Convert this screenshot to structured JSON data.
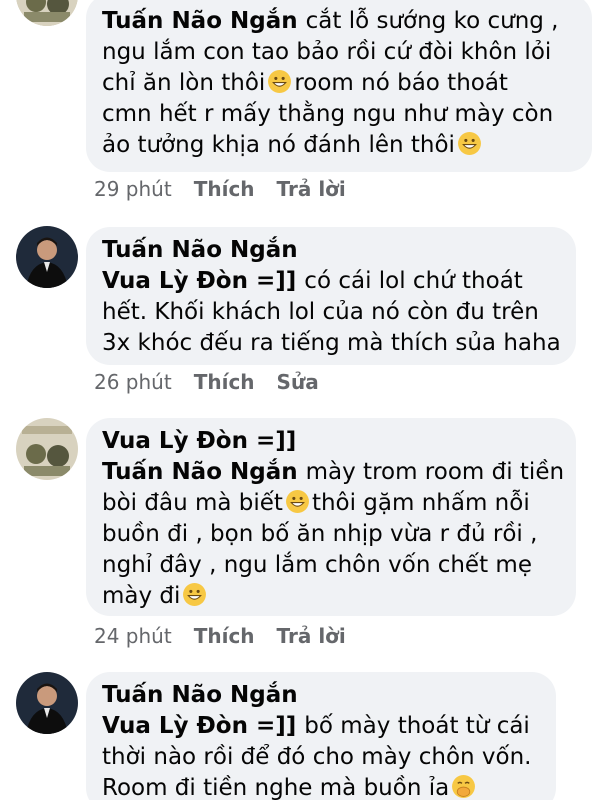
{
  "comments": [
    {
      "author": "",
      "mention": "Tuấn Não Ngắn",
      "lines": [
        {
          "pre": "cắt lỗ sướng ko cưng ,",
          "emoji": false,
          "post": ""
        },
        {
          "pre": "ngu lắm con tao bảo rồi cứ đòi khôn lỏi",
          "emoji": false,
          "post": ""
        },
        {
          "pre": "chỉ ăn lòn thôi",
          "emoji": true,
          "post": "room nó báo thoát"
        },
        {
          "pre": "cmn hết r mấy thằng ngu như mày còn",
          "emoji": false,
          "post": ""
        },
        {
          "pre": "ảo tưởng khịa nó đánh lên thôi",
          "emoji": true,
          "post": ""
        }
      ],
      "time": "29 phút",
      "like": "Thích",
      "action2": "Trả lời"
    },
    {
      "author": "Tuấn Não Ngắn",
      "mention": "Vua Lỳ Đòn =]]",
      "lines": [
        {
          "pre": "có cái lol chứ thoát",
          "emoji": false,
          "post": ""
        },
        {
          "pre": "hết. Khối khách lol của nó còn đu trên",
          "emoji": false,
          "post": ""
        },
        {
          "pre": "3x khóc đếu ra tiếng mà thích sủa haha",
          "emoji": false,
          "post": ""
        }
      ],
      "time": "26 phút",
      "like": "Thích",
      "action2": "Sửa"
    },
    {
      "author": "Vua Lỳ Đòn =]]",
      "mention": "Tuấn Não Ngắn",
      "lines": [
        {
          "pre": "mày trom room đi tiền",
          "emoji": false,
          "post": ""
        },
        {
          "pre": "bòi đâu mà biết",
          "emoji": true,
          "post": "thôi gặm nhấm nỗi"
        },
        {
          "pre": "buồn đi , bọn bố ăn nhịp vừa r đủ rồi ,",
          "emoji": false,
          "post": ""
        },
        {
          "pre": "nghỉ đây , ngu lắm chôn vốn chết mẹ",
          "emoji": false,
          "post": ""
        },
        {
          "pre": "mày đi",
          "emoji": true,
          "post": ""
        }
      ],
      "time": "24 phút",
      "like": "Thích",
      "action2": "Trả lời"
    },
    {
      "author": "Tuấn Não Ngắn",
      "mention": "Vua Lỳ Đòn =]]",
      "lines": [
        {
          "pre": "bố mày thoát từ cái",
          "emoji": false,
          "post": ""
        },
        {
          "pre": "thời nào rồi để đó cho mày chôn vốn.",
          "emoji": false,
          "post": ""
        },
        {
          "pre": "Room đi tiền nghe mà buồn ỉa",
          "emoji": true,
          "emojiType": "hush",
          "post": ""
        }
      ],
      "time": "",
      "like": "",
      "action2": ""
    }
  ],
  "colors": {
    "bubble": "#f0f2f5",
    "text": "#050505",
    "meta": "#65676b",
    "emoji": "#f7c844"
  },
  "icons": {
    "grin": "grinning-face-icon",
    "hush": "face-with-hand-over-mouth-icon"
  }
}
